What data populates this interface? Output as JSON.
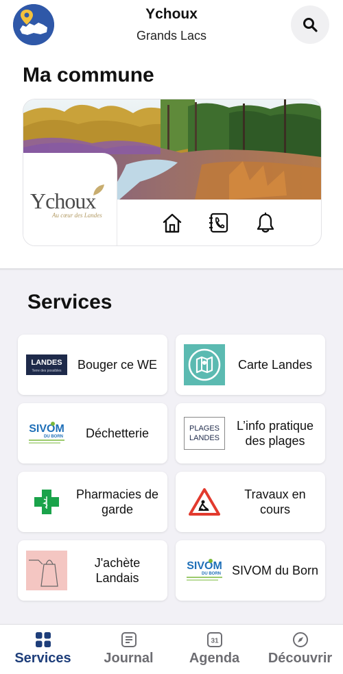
{
  "header": {
    "title": "Ychoux",
    "subtitle": "Grands Lacs",
    "search_icon": "search-icon",
    "avatar_icon": "commune-map-icon"
  },
  "commune": {
    "section_title": "Ma commune",
    "logo_name": "Ychoux",
    "logo_tagline": "Au cœur des Landes",
    "actions": [
      {
        "name": "home-icon"
      },
      {
        "name": "phone-book-icon"
      },
      {
        "name": "bell-icon"
      }
    ]
  },
  "services": {
    "section_title": "Services",
    "items": [
      {
        "label": "Bouger ce WE",
        "icon": "landes-logo",
        "logo_text": "LANDES",
        "logo_sub": "Terre des possibles"
      },
      {
        "label": "Carte Landes",
        "icon": "map-pin-icon"
      },
      {
        "label": "Déchetterie",
        "icon": "sivom-logo",
        "logo_text": "SIVOM",
        "logo_sub": "DU BORN"
      },
      {
        "label": "L’info pratique des plages",
        "icon": "plages-landes-logo",
        "logo_text": "PLAGES",
        "logo_sub": "LANDES"
      },
      {
        "label": "Pharmacies de garde",
        "icon": "pharmacy-cross-icon"
      },
      {
        "label": "Travaux en cours",
        "icon": "roadworks-sign-icon"
      },
      {
        "label": "J'achète Landais",
        "icon": "shopping-bag-icon"
      },
      {
        "label": "SIVOM du Born",
        "icon": "sivom-logo",
        "logo_text": "SIVOM",
        "logo_sub": "DU BORN"
      }
    ]
  },
  "tabs": [
    {
      "label": "Services",
      "icon": "grid-icon",
      "active": true
    },
    {
      "label": "Journal",
      "icon": "journal-icon",
      "active": false
    },
    {
      "label": "Agenda",
      "icon": "calendar-icon",
      "day": "31",
      "active": false
    },
    {
      "label": "Découvrir",
      "icon": "compass-icon",
      "active": false
    }
  ],
  "colors": {
    "accent": "#1e3e7a",
    "services_background": "#f2f1f6",
    "tab_inactive": "#6d6d72",
    "pharmacy_green": "#1aa34a"
  }
}
